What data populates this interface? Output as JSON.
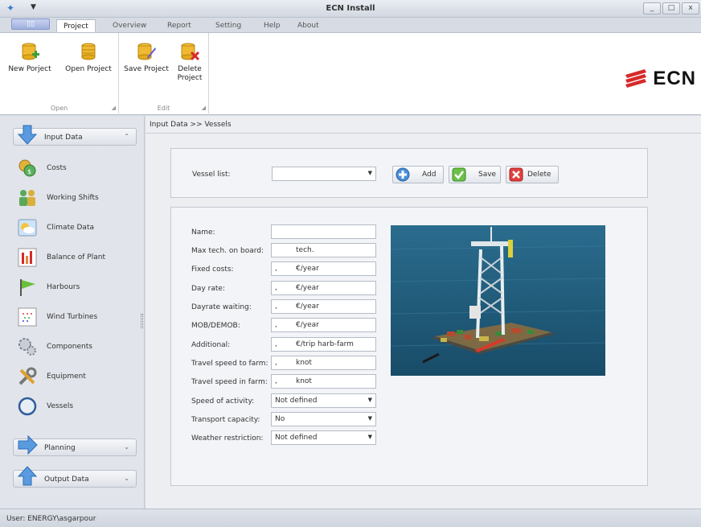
{
  "window": {
    "title": "ECN Install",
    "controls": [
      "_",
      "□",
      "x"
    ]
  },
  "ribbon": {
    "tabs": [
      "Project",
      "Overview",
      "Report",
      "Setting",
      "Help",
      "About"
    ],
    "active_tab": "Project",
    "groups": [
      {
        "label": "Open",
        "buttons": [
          {
            "label": "New Porject",
            "icon": "new-project-icon"
          },
          {
            "label": "Open Project",
            "icon": "open-project-icon"
          }
        ]
      },
      {
        "label": "Edit",
        "buttons": [
          {
            "label": "Save Project",
            "icon": "save-project-icon"
          },
          {
            "label": "Delete Project",
            "icon": "delete-project-icon"
          }
        ]
      }
    ],
    "logo_text": "ECN"
  },
  "sidebar": {
    "input_data": "Input Data",
    "items": [
      "Costs",
      "Working Shifts",
      "Climate Data",
      "Balance of Plant",
      "Harbours",
      "Wind Turbines",
      "Components",
      "Equipment",
      "Vessels"
    ],
    "planning": "Planning",
    "output_data": "Output Data"
  },
  "main": {
    "breadcrumb": "Input Data >> Vessels",
    "vessel_list_label": "Vessel list:",
    "vessel_list_value": "",
    "buttons": {
      "add": "Add",
      "save": "Save",
      "delete": "Delete"
    },
    "fields": [
      {
        "label": "Name:",
        "value": "",
        "unit": ""
      },
      {
        "label": "Max tech. on board:",
        "value": "",
        "unit": "tech."
      },
      {
        "label": "Fixed costs:",
        "value": ",",
        "unit": "€/year"
      },
      {
        "label": "Day rate:",
        "value": ",",
        "unit": "€/year"
      },
      {
        "label": "Dayrate waiting:",
        "value": ",",
        "unit": "€/year"
      },
      {
        "label": "MOB/DEMOB:",
        "value": ",",
        "unit": "€/year"
      },
      {
        "label": "Additional:",
        "value": ",",
        "unit": "€/trip harb-farm"
      },
      {
        "label": "Travel speed to farm:",
        "value": ",",
        "unit": "knot"
      },
      {
        "label": "Travel speed in farm:",
        "value": ",",
        "unit": "knot"
      }
    ],
    "selects": [
      {
        "label": "Speed of activity:",
        "value": "Not defined"
      },
      {
        "label": "Transport capacity:",
        "value": "No"
      },
      {
        "label": "Weather restriction:",
        "value": "Not defined"
      }
    ]
  },
  "status": {
    "user": "User: ENERGY\\asgarpour"
  },
  "colors": {
    "ribbon_bg": "#ffffff",
    "sea": "#1f5d7e",
    "accent_red": "#d62a2a",
    "accent_blue": "#3a7bc8"
  }
}
